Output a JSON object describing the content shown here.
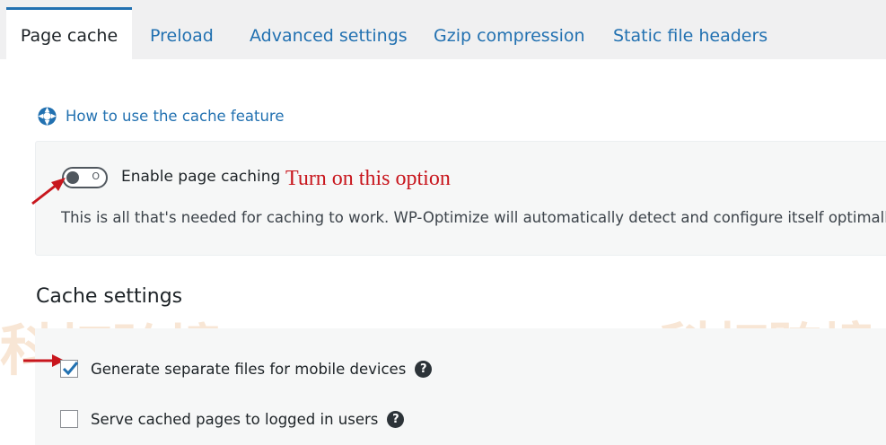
{
  "tabs": [
    {
      "label": "Page cache",
      "active": true
    },
    {
      "label": "Preload",
      "active": false
    },
    {
      "label": "Advanced settings",
      "active": false
    },
    {
      "label": "Gzip compression",
      "active": false
    },
    {
      "label": "Static file headers",
      "active": false
    }
  ],
  "help_link": {
    "label": "How to use the cache feature",
    "icon": "lifebuoy-icon"
  },
  "page_caching": {
    "toggle_label": "Enable page caching",
    "toggle_on": false,
    "toggle_glyph": "O",
    "description": "This is all that's needed for caching to work. WP-Optimize will automatically detect and configure itself optimally fo"
  },
  "annotation": {
    "text": "Turn on this option",
    "color": "#c8161d"
  },
  "cache_settings": {
    "heading": "Cache settings",
    "options": [
      {
        "label": "Generate separate files for mobile devices",
        "checked": true
      },
      {
        "label": "Serve cached pages to logged in users",
        "checked": false
      }
    ]
  },
  "watermark": {
    "text": "科灯跨境"
  },
  "colors": {
    "accent": "#2271b1",
    "annotation_red": "#c8161d",
    "panel": "#f6f7f7",
    "tabbar": "#f0f0f1"
  }
}
